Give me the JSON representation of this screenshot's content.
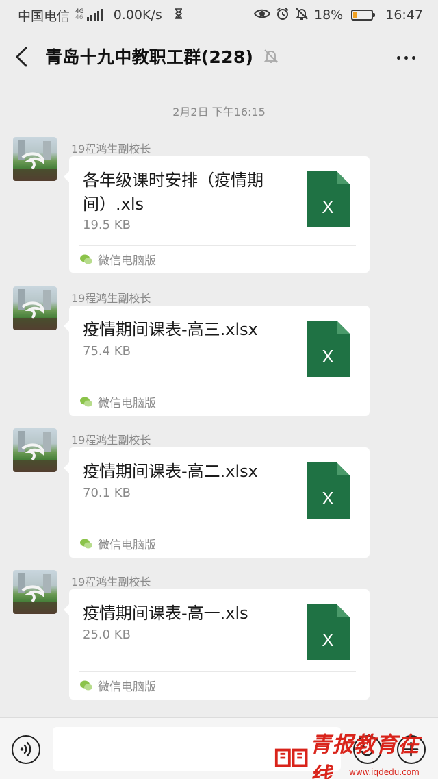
{
  "status_bar": {
    "carrier": "中国电信",
    "network_type": "4G",
    "network_sub": "46",
    "speed": "0.00K/s",
    "battery_percent": "18%",
    "battery_level": 0.18,
    "time": "16:47",
    "icons": [
      "hourglass-icon",
      "eye-icon",
      "alarm-icon",
      "bell-off-icon",
      "battery-icon"
    ]
  },
  "header": {
    "title": "青岛十九中教职工群(228)",
    "icons": [
      "back-icon",
      "mute-icon",
      "more-icon"
    ]
  },
  "chat": {
    "timestamp": "2月2日 下午16:15",
    "messages": [
      {
        "sender": "19程鸿生副校长",
        "file_name": "各年级课时安排（疫情期间）.xls",
        "file_size": "19.5 KB",
        "file_icon_letter": "X",
        "source": "微信电脑版"
      },
      {
        "sender": "19程鸿生副校长",
        "file_name": "疫情期间课表-高三.xlsx",
        "file_size": "75.4 KB",
        "file_icon_letter": "X",
        "source": "微信电脑版"
      },
      {
        "sender": "19程鸿生副校长",
        "file_name": "疫情期间课表-高二.xlsx",
        "file_size": "70.1 KB",
        "file_icon_letter": "X",
        "source": "微信电脑版"
      },
      {
        "sender": "19程鸿生副校长",
        "file_name": "疫情期间课表-高一.xls",
        "file_size": "25.0 KB",
        "file_icon_letter": "X",
        "source": "微信电脑版"
      }
    ]
  },
  "input_bar": {
    "icons": [
      "voice-icon",
      "emoji-icon",
      "plus-icon"
    ]
  },
  "watermark": {
    "text": "青报教育在线",
    "url": "www.iqdedu.com"
  },
  "colors": {
    "excel_green": "#1f7244",
    "background": "#ededed",
    "card": "#ffffff",
    "watermark_red": "#d9241b"
  }
}
